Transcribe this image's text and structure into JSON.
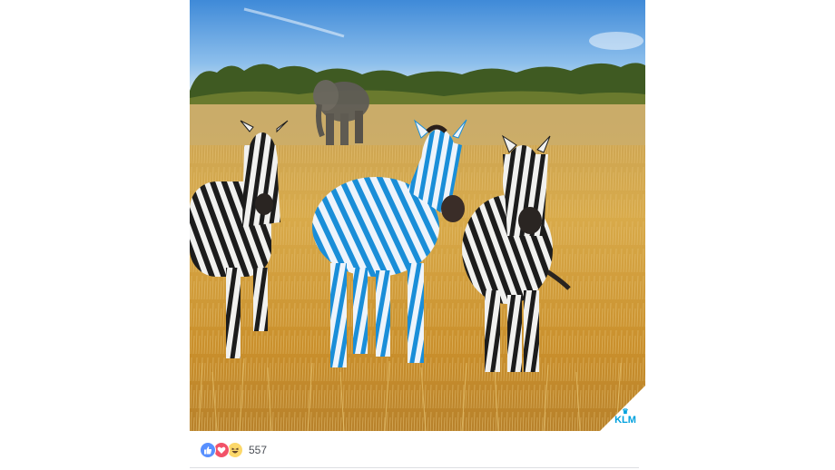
{
  "post": {
    "brand_logo": {
      "text": "KLM",
      "color": "#00a1de",
      "icon": "crown-icon"
    },
    "reactions": {
      "icons": [
        "like-icon",
        "love-icon",
        "haha-icon"
      ],
      "count": "557",
      "colors": {
        "like": "#5890ff",
        "love": "#f25268",
        "haha": "#fcd86a"
      }
    }
  }
}
